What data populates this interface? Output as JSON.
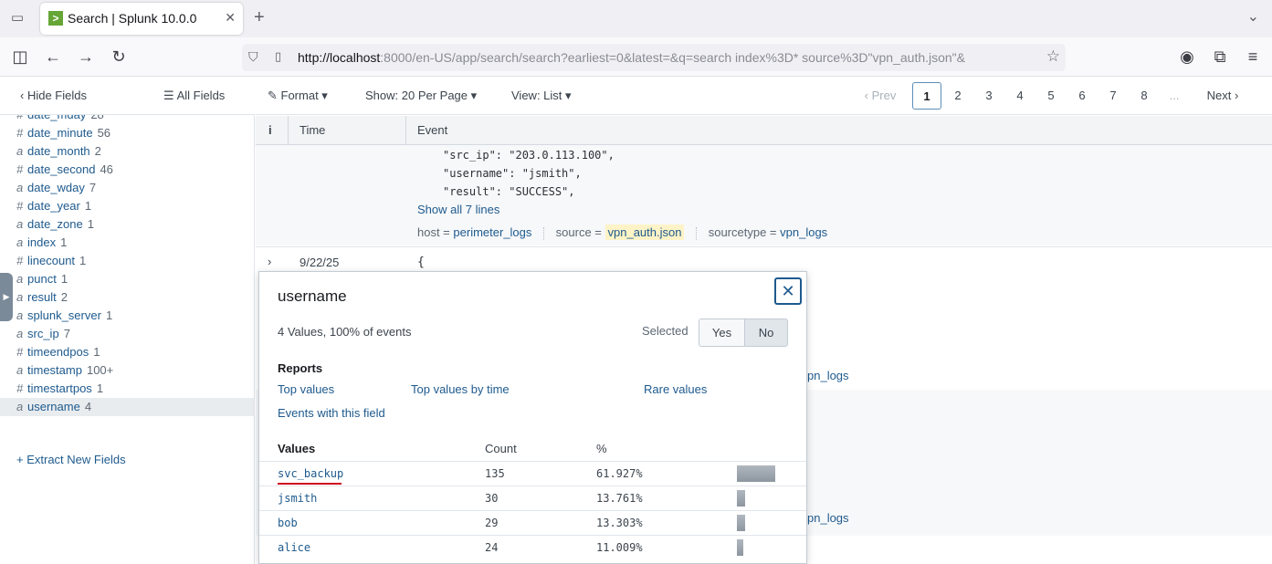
{
  "browser": {
    "tab_title": "Search | Splunk 10.0.0",
    "tab_favicon": ">",
    "url_host": "http://localhost",
    "url_rest": ":8000/en-US/app/search/search?earliest=0&latest=&q=search index%3D* source%3D\"vpn_auth.json\"&"
  },
  "sidebar": {
    "hide_fields": "Hide Fields",
    "all_fields": "All Fields",
    "fields": [
      {
        "type": "#",
        "name": "date_mday",
        "count": "28"
      },
      {
        "type": "#",
        "name": "date_minute",
        "count": "56"
      },
      {
        "type": "a",
        "name": "date_month",
        "count": "2"
      },
      {
        "type": "#",
        "name": "date_second",
        "count": "46"
      },
      {
        "type": "a",
        "name": "date_wday",
        "count": "7"
      },
      {
        "type": "#",
        "name": "date_year",
        "count": "1"
      },
      {
        "type": "a",
        "name": "date_zone",
        "count": "1"
      },
      {
        "type": "a",
        "name": "index",
        "count": "1"
      },
      {
        "type": "#",
        "name": "linecount",
        "count": "1"
      },
      {
        "type": "a",
        "name": "punct",
        "count": "1"
      },
      {
        "type": "a",
        "name": "result",
        "count": "2"
      },
      {
        "type": "a",
        "name": "splunk_server",
        "count": "1"
      },
      {
        "type": "a",
        "name": "src_ip",
        "count": "7"
      },
      {
        "type": "#",
        "name": "timeendpos",
        "count": "1"
      },
      {
        "type": "a",
        "name": "timestamp",
        "count": "100+"
      },
      {
        "type": "#",
        "name": "timestartpos",
        "count": "1"
      },
      {
        "type": "a",
        "name": "username",
        "count": "4"
      }
    ],
    "extract": "+ Extract New Fields"
  },
  "toolbar": {
    "format": "Format",
    "show": "Show: 20 Per Page",
    "view": "View: List",
    "prev": "Prev",
    "pages": [
      "1",
      "2",
      "3",
      "4",
      "5",
      "6",
      "7",
      "8"
    ],
    "ellipsis": "...",
    "next": "Next"
  },
  "table": {
    "col_info": "i",
    "col_time": "Time",
    "col_event": "Event"
  },
  "event1": {
    "lines": [
      "\"src_ip\": \"203.0.113.100\",",
      "\"username\": \"jsmith\",",
      "\"result\": \"SUCCESS\","
    ],
    "show_all": "Show all 7 lines",
    "host_label": "host =",
    "host_value": "perimeter_logs",
    "source_label": "source =",
    "source_value": "vpn_auth.json",
    "sourcetype_label": "sourcetype =",
    "sourcetype_value": "vpn_logs"
  },
  "event2": {
    "time": "9/22/25",
    "brace": "{",
    "peek_value": "pn_logs"
  },
  "event3": {
    "peek_value": "pn_logs"
  },
  "popup": {
    "title": "username",
    "summary": "4 Values, 100% of events",
    "selected_label": "Selected",
    "yes": "Yes",
    "no": "No",
    "reports_label": "Reports",
    "top_values": "Top values",
    "top_values_by_time": "Top values by time",
    "rare_values": "Rare values",
    "events_with_field": "Events with this field",
    "col_values": "Values",
    "col_count": "Count",
    "col_pct": "%",
    "values": [
      {
        "value": "svc_backup",
        "count": "135",
        "pct": "61.927%",
        "fraction": 0.61927
      },
      {
        "value": "jsmith",
        "count": "30",
        "pct": "13.761%",
        "fraction": 0.13761
      },
      {
        "value": "bob",
        "count": "29",
        "pct": "13.303%",
        "fraction": 0.13303
      },
      {
        "value": "alice",
        "count": "24",
        "pct": "11.009%",
        "fraction": 0.11009
      }
    ]
  },
  "colors": {
    "link": "#1e5a8e",
    "favicon": "#65a637",
    "underline": "#d0021b"
  }
}
